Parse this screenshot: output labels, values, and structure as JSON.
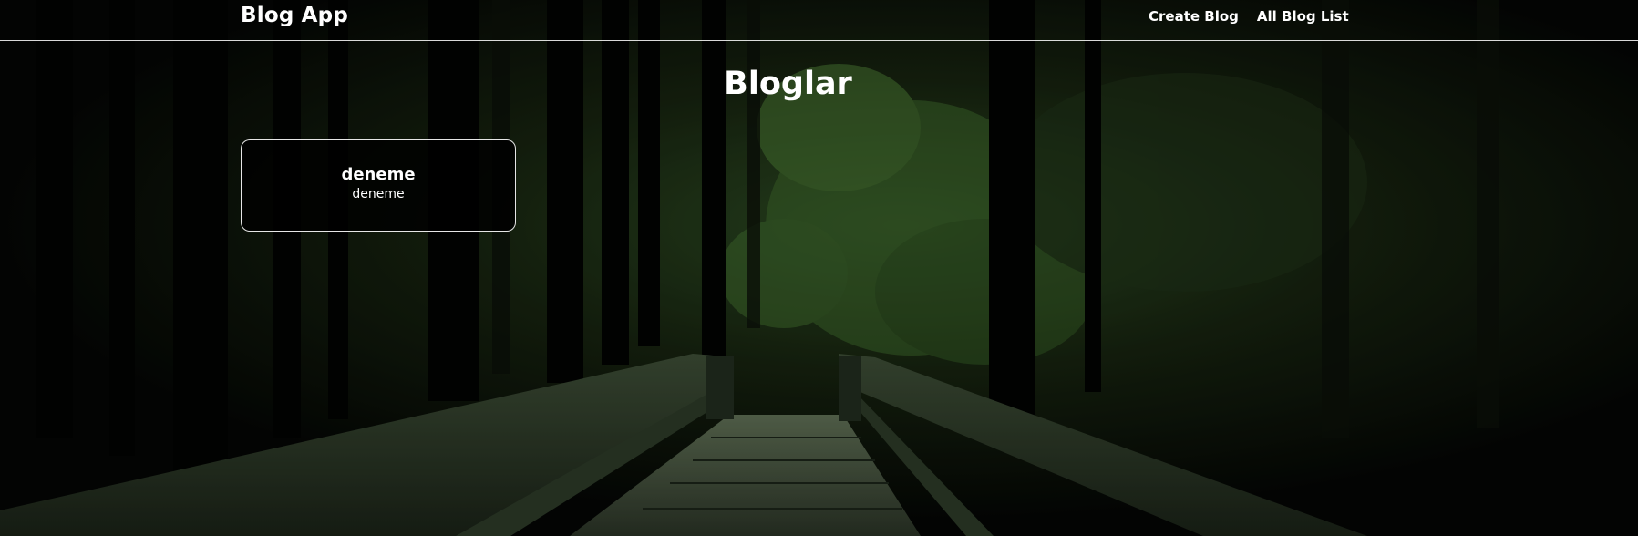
{
  "navbar": {
    "brand": "Blog App",
    "links": [
      "Create Blog",
      "All Blog List"
    ]
  },
  "main": {
    "title": "Bloglar",
    "blogs": [
      {
        "title": "deneme",
        "content": "deneme"
      }
    ]
  },
  "background": {
    "description_icon": "forest-bridge-image",
    "colors": {
      "dark": "#050705",
      "foliage": "#6f9a4e",
      "bridge": "#2e3a2a"
    }
  }
}
